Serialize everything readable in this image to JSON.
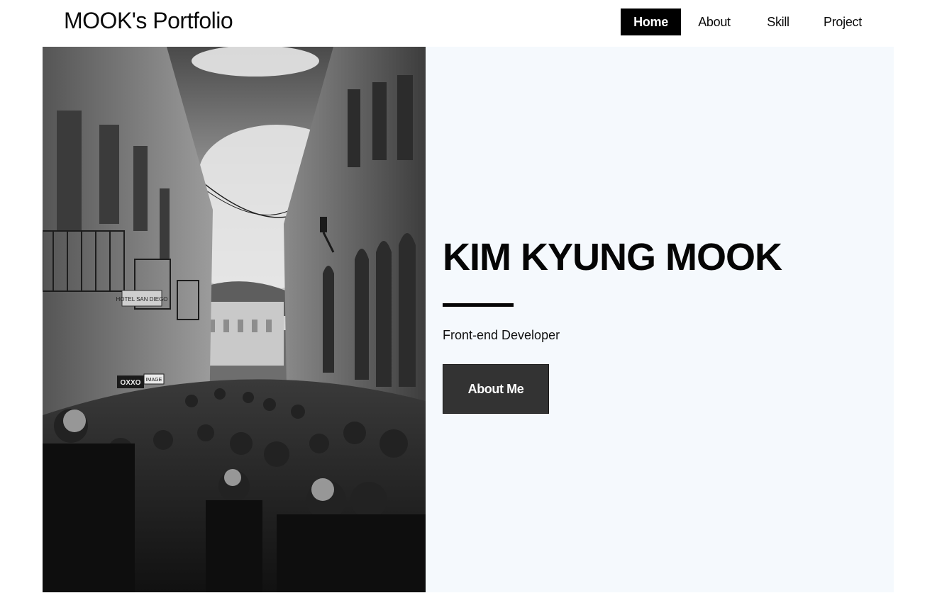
{
  "header": {
    "brand": "MOOK's Portfolio"
  },
  "nav": {
    "items": [
      {
        "label": "Home",
        "active": true
      },
      {
        "label": "About",
        "active": false
      },
      {
        "label": "Skill",
        "active": false
      },
      {
        "label": "Project",
        "active": false
      }
    ]
  },
  "hero": {
    "name": "KIM KYUNG MOOK",
    "role": "Front-end Developer",
    "cta_label": "About Me",
    "photo": {
      "signs": [
        "HOTEL SAN DIEGO",
        "OXXO",
        "IMAGE"
      ]
    }
  },
  "colors": {
    "background": "#ffffff",
    "hero_background": "#f5f9fd",
    "nav_active": "#000000",
    "button": "#333333",
    "text": "#050505"
  }
}
